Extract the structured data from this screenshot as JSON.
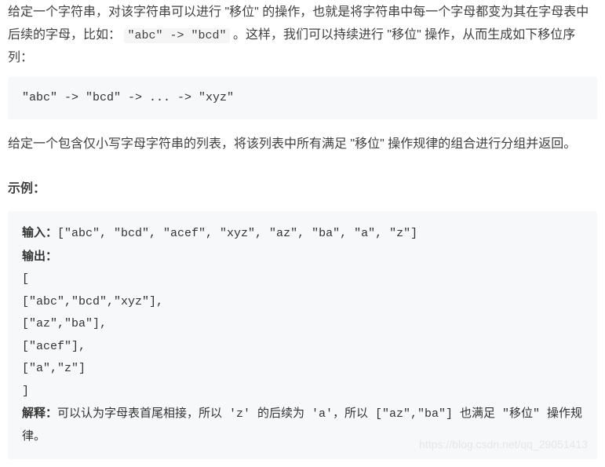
{
  "intro": {
    "p1_a": "给定一个字符串，对该字符串可以进行 \"移位\" 的操作，也就是将字符串中每一个字母都变为其在字母表中后续的字母，比如：",
    "inline_code": "\"abc\" -> \"bcd\"",
    "p1_b": "。这样，我们可以持续进行 \"移位\" 操作，从而生成如下移位序列：",
    "code_block": "\"abc\" -> \"bcd\" -> ... -> \"xyz\"",
    "p2": "给定一个包含仅小写字母字符串的列表，将该列表中所有满足 \"移位\" 操作规律的组合进行分组并返回。"
  },
  "example": {
    "heading": "示例：",
    "input_label": "输入：",
    "input_value": "[\"abc\", \"bcd\", \"acef\", \"xyz\", \"az\", \"ba\", \"a\", \"z\"]",
    "output_label": "输出：",
    "output_lines": [
      "[",
      "  [\"abc\",\"bcd\",\"xyz\"],",
      "  [\"az\",\"ba\"],",
      "  [\"acef\"],",
      "  [\"a\",\"z\"]",
      "]"
    ],
    "explain_label": "解释：",
    "explain_text": "可以认为字母表首尾相接，所以 'z' 的后续为 'a'，所以 [\"az\",\"ba\"] 也满足 \"移位\" 操作规律。"
  },
  "watermark": "https://blog.csdn.net/qq_29051413"
}
